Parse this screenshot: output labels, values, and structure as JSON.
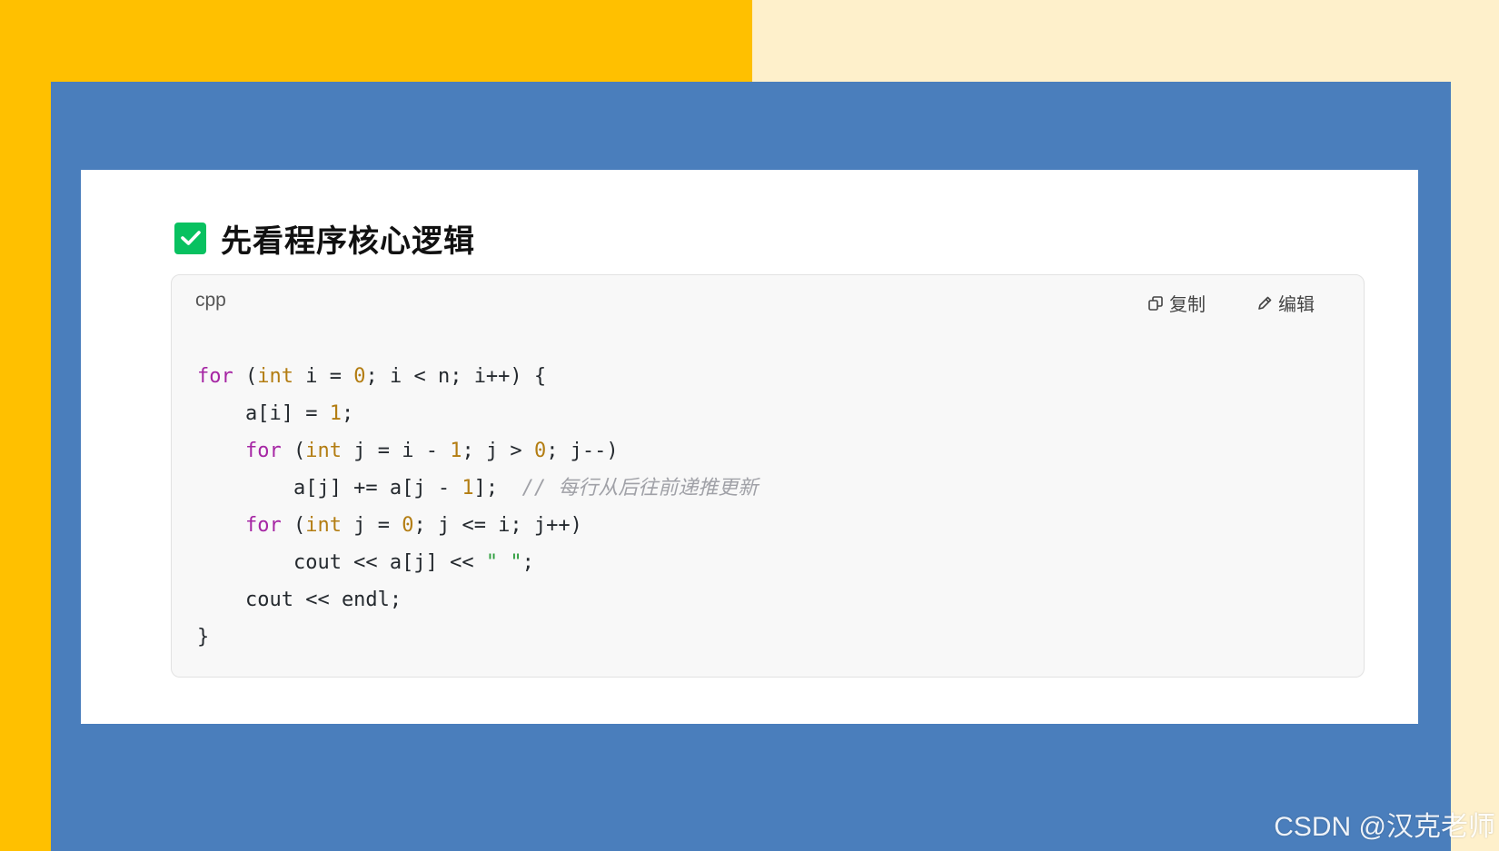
{
  "colors": {
    "background_light": "#FEF0CB",
    "background_yellow": "#FFC000",
    "panel_blue": "#4A7EBC",
    "card_white": "#FFFFFF",
    "check_green": "#08C160",
    "keyword": "#A626A4",
    "type_and_number": "#B37D12",
    "string": "#2E9E3E",
    "comment": "#A0A1A7"
  },
  "heading": {
    "icon": "check-box-icon",
    "title": "先看程序核心逻辑"
  },
  "code_block": {
    "language": "cpp",
    "copy_icon": "copy-icon",
    "copy_label": "复制",
    "edit_icon": "edit-icon",
    "edit_label": "编辑",
    "lines": [
      [
        {
          "t": "for",
          "c": "kw"
        },
        {
          "t": " ("
        },
        {
          "t": "int",
          "c": "ty"
        },
        {
          "t": " i = "
        },
        {
          "t": "0",
          "c": "num"
        },
        {
          "t": "; i < n; i++) {"
        }
      ],
      [
        {
          "t": "    a[i] = "
        },
        {
          "t": "1",
          "c": "num"
        },
        {
          "t": ";"
        }
      ],
      [
        {
          "t": "    "
        },
        {
          "t": "for",
          "c": "kw"
        },
        {
          "t": " ("
        },
        {
          "t": "int",
          "c": "ty"
        },
        {
          "t": " j = i - "
        },
        {
          "t": "1",
          "c": "num"
        },
        {
          "t": "; j > "
        },
        {
          "t": "0",
          "c": "num"
        },
        {
          "t": "; j--)"
        }
      ],
      [
        {
          "t": "        a[j] += a[j - "
        },
        {
          "t": "1",
          "c": "num"
        },
        {
          "t": "];  "
        },
        {
          "t": "// 每行从后往前递推更新",
          "c": "cm"
        }
      ],
      [
        {
          "t": "    "
        },
        {
          "t": "for",
          "c": "kw"
        },
        {
          "t": " ("
        },
        {
          "t": "int",
          "c": "ty"
        },
        {
          "t": " j = "
        },
        {
          "t": "0",
          "c": "num"
        },
        {
          "t": "; j <= i; j++)"
        }
      ],
      [
        {
          "t": "        cout << a[j] << "
        },
        {
          "t": "\" \"",
          "c": "str"
        },
        {
          "t": ";"
        }
      ],
      [
        {
          "t": "    cout << endl;"
        }
      ],
      [
        {
          "t": "}"
        }
      ]
    ]
  },
  "watermark": "CSDN @汉克老师"
}
